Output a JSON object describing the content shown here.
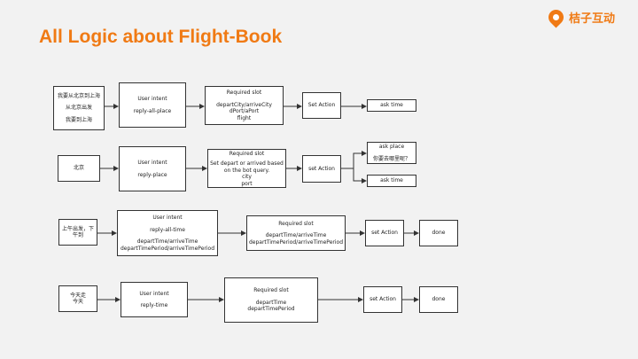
{
  "title": "All Logic about Flight-Book",
  "logo": {
    "text": "桔子互动",
    "color": "#f07a14"
  },
  "rows": [
    {
      "input": [
        "我要从北京到上海",
        "从北京出发",
        "我要到上海"
      ],
      "intent": [
        "User intent",
        "reply-all-place"
      ],
      "slot": [
        "Required slot",
        "departCity/arriveCity",
        "dPort/aPort",
        "flight"
      ],
      "action": "Set Action",
      "results": [
        {
          "lines": [
            "ask time"
          ]
        }
      ]
    },
    {
      "input": [
        "北京"
      ],
      "intent": [
        "User intent",
        "reply-place"
      ],
      "slot": [
        "Required slot",
        "Set depart or arrived based",
        "on the bot query.",
        "city",
        "port"
      ],
      "action": "set Action",
      "results": [
        {
          "lines": [
            "ask place",
            "你要去哪里呢？"
          ]
        },
        {
          "lines": [
            "ask time"
          ]
        }
      ]
    },
    {
      "input": [
        "上午出发，下",
        "午到"
      ],
      "intent": [
        "User intent",
        "reply-all-time",
        "departTime/arriveTime",
        "departTimePeriod/arriveTimePeriod"
      ],
      "slot": [
        "Required slot",
        "departTime/arriveTime",
        "departTimePeriod/arriveTimePeriod"
      ],
      "action": "set Action",
      "results": [
        {
          "lines": [
            "done"
          ]
        }
      ]
    },
    {
      "input": [
        "今天走",
        "今天"
      ],
      "intent": [
        "User intent",
        "reply-time"
      ],
      "slot": [
        "Required slot",
        "departTime",
        "departTimePeriod"
      ],
      "action": "set Action",
      "results": [
        {
          "lines": [
            "done"
          ]
        }
      ]
    }
  ]
}
